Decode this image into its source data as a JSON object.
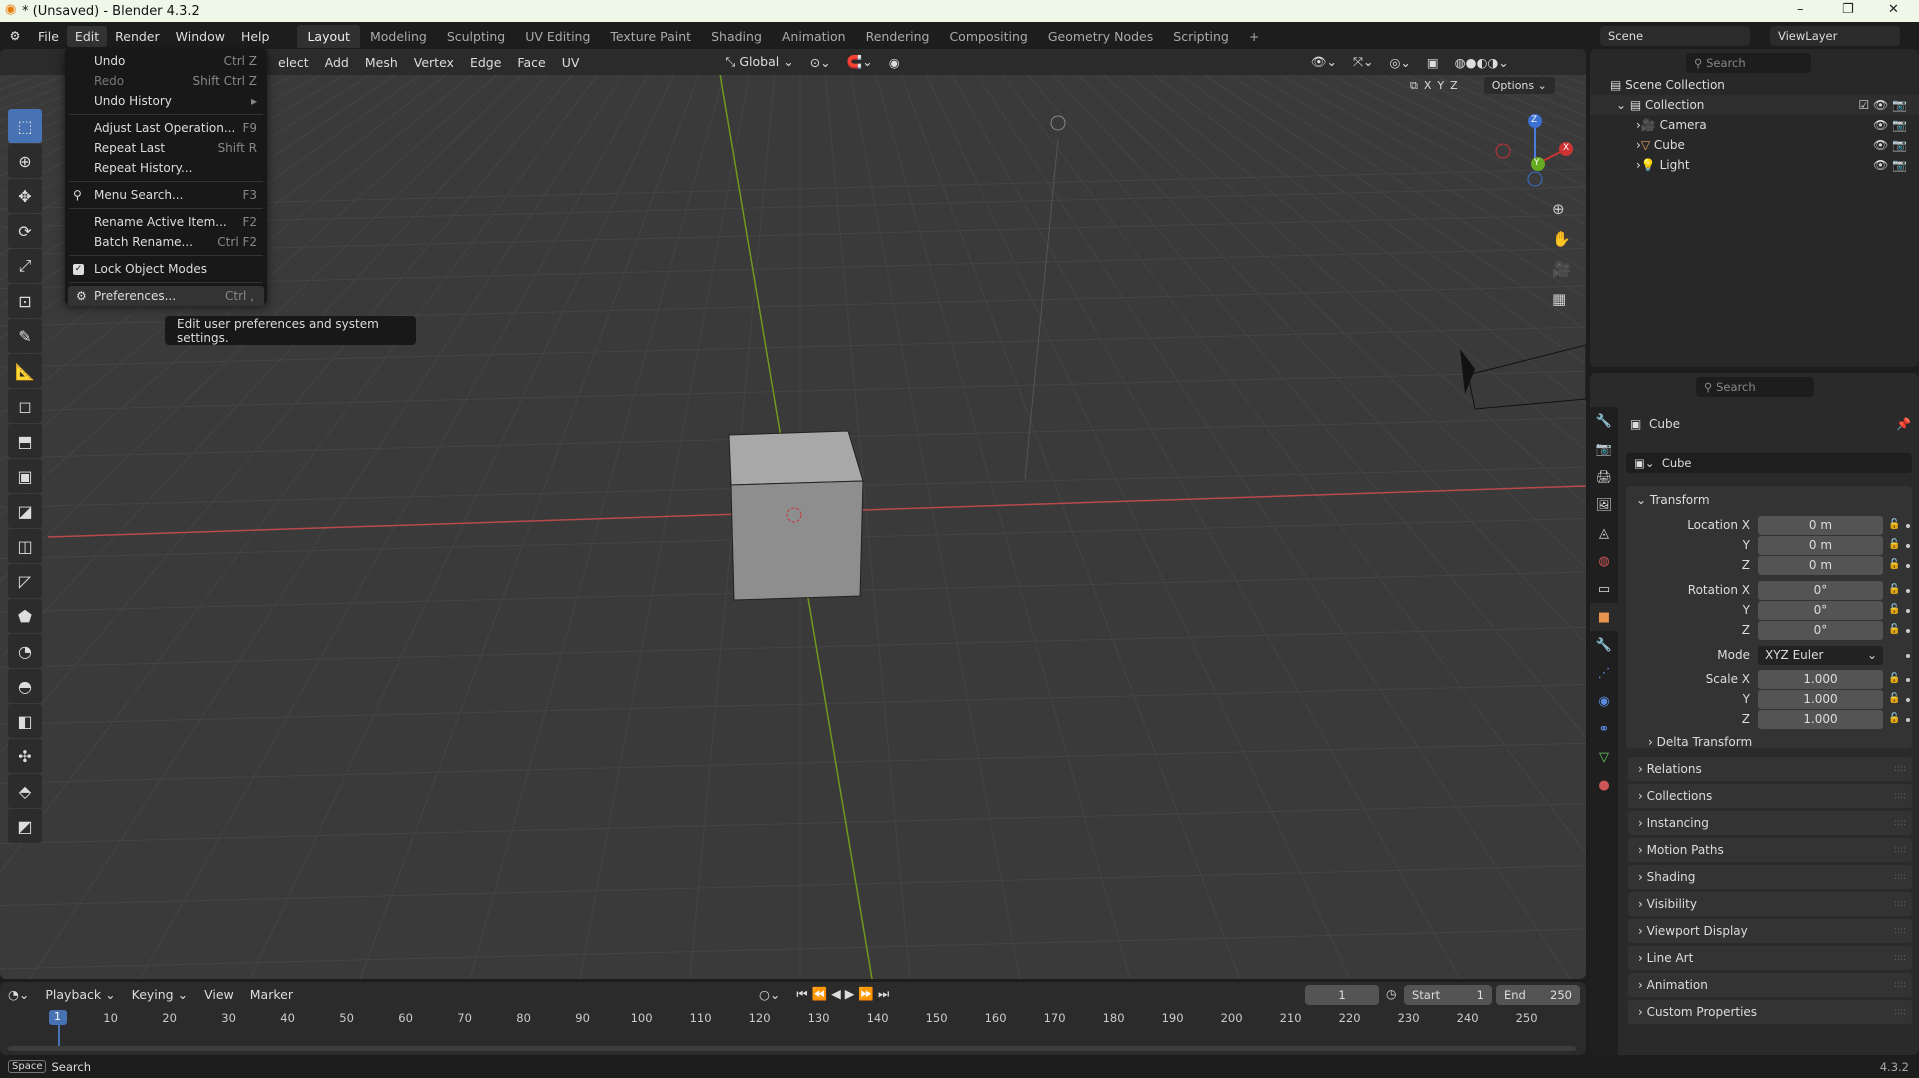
{
  "window": {
    "title": "* (Unsaved) - Blender 4.3.2",
    "minimize": "–",
    "maximize": "❐",
    "close": "✕"
  },
  "menubar": {
    "items": [
      "File",
      "Edit",
      "Render",
      "Window",
      "Help"
    ],
    "workspaces": [
      "Layout",
      "Modeling",
      "Sculpting",
      "UV Editing",
      "Texture Paint",
      "Shading",
      "Animation",
      "Rendering",
      "Compositing",
      "Geometry Nodes",
      "Scripting"
    ],
    "add_tab": "+",
    "scene": "Scene",
    "view_layer": "ViewLayer"
  },
  "viewport": {
    "menus": [
      "elect",
      "Add",
      "Mesh",
      "Vertex",
      "Edge",
      "Face",
      "UV"
    ],
    "orientation": "Global",
    "options": "Options",
    "axes": [
      "X",
      "Y",
      "Z"
    ],
    "gizmo": {
      "x": "X",
      "y": "Y",
      "z": "Z"
    }
  },
  "edit_menu": {
    "items": [
      {
        "label": "Undo",
        "key": "Ctrl Z"
      },
      {
        "label": "Redo",
        "key": "Shift Ctrl Z",
        "disabled": true
      },
      {
        "label": "Undo History",
        "key": "▸"
      },
      {
        "label": "Adjust Last Operation...",
        "key": "F9"
      },
      {
        "label": "Repeat Last",
        "key": "Shift R"
      },
      {
        "label": "Repeat History...",
        "key": ""
      },
      {
        "label": "Menu Search...",
        "key": "F3"
      },
      {
        "label": "Rename Active Item...",
        "key": "F2"
      },
      {
        "label": "Batch Rename...",
        "key": "Ctrl F2"
      },
      {
        "label": "Lock Object Modes",
        "key": "",
        "checked": true
      },
      {
        "label": "Preferences...",
        "key": "Ctrl ,"
      }
    ]
  },
  "tooltip": "Edit user preferences and system settings.",
  "outliner": {
    "search_placeholder": "Search",
    "root": "Scene Collection",
    "collection": "Collection",
    "objects": [
      "Camera",
      "Cube",
      "Light"
    ]
  },
  "properties": {
    "search_placeholder": "Search",
    "object_name": "Cube",
    "datablock": "Cube",
    "transform_label": "Transform",
    "location": {
      "label": "Location X",
      "x": "0 m",
      "y": "0 m",
      "z": "0 m"
    },
    "rotation": {
      "label": "Rotation X",
      "x": "0°",
      "y": "0°",
      "z": "0°"
    },
    "mode": {
      "label": "Mode",
      "value": "XYZ Euler"
    },
    "scale": {
      "label": "Scale X",
      "x": "1.000",
      "y": "1.000",
      "z": "1.000"
    },
    "axis_y": "Y",
    "axis_z": "Z",
    "delta": "Delta Transform",
    "panels": [
      "Relations",
      "Collections",
      "Instancing",
      "Motion Paths",
      "Shading",
      "Visibility",
      "Viewport Display",
      "Line Art",
      "Animation",
      "Custom Properties"
    ]
  },
  "timeline": {
    "menus": [
      "Playback",
      "Keying",
      "View",
      "Marker"
    ],
    "current_frame": "1",
    "start_label": "Start",
    "start": "1",
    "end_label": "End",
    "end": "250",
    "ticks": [
      10,
      20,
      30,
      40,
      50,
      60,
      70,
      80,
      90,
      100,
      110,
      120,
      130,
      140,
      150,
      160,
      170,
      180,
      190,
      200,
      210,
      220,
      230,
      240,
      250
    ]
  },
  "status": {
    "key": "Space",
    "action": "Search",
    "version": "4.3.2"
  }
}
